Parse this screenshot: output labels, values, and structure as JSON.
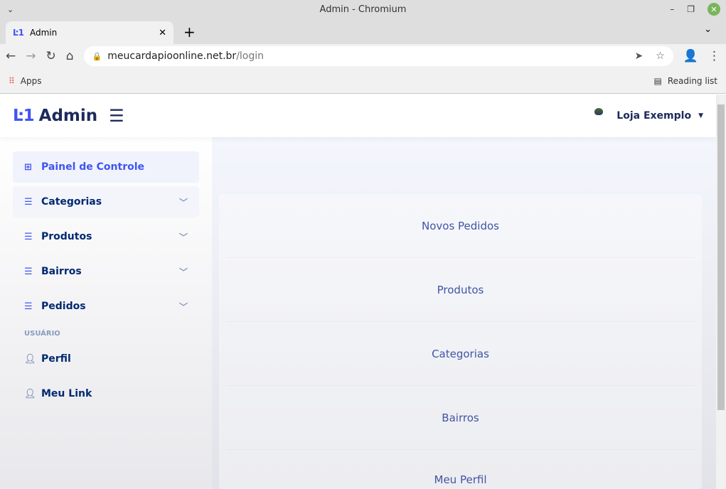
{
  "window": {
    "title": "Admin - Chromium"
  },
  "tab": {
    "label": "Admin"
  },
  "address": {
    "host": "meucardapioonline.net.br",
    "path": "/login"
  },
  "bookmarks": {
    "apps": "Apps",
    "reading_list": "Reading list"
  },
  "header": {
    "brand": "Admin",
    "user": "Loja Exemplo",
    "logo_text": "Loja Exemplo"
  },
  "sidebar": {
    "items": [
      {
        "label": "Painel de Controle"
      },
      {
        "label": "Categorias"
      },
      {
        "label": "Produtos"
      },
      {
        "label": "Bairros"
      },
      {
        "label": "Pedidos"
      }
    ],
    "section": "USUÁRIO",
    "user_items": [
      {
        "label": "Perfil"
      },
      {
        "label": "Meu Link"
      }
    ]
  },
  "main": {
    "links": [
      "Novos Pedidos",
      "Produtos",
      "Categorias",
      "Bairros",
      "Meu Perfil"
    ]
  }
}
